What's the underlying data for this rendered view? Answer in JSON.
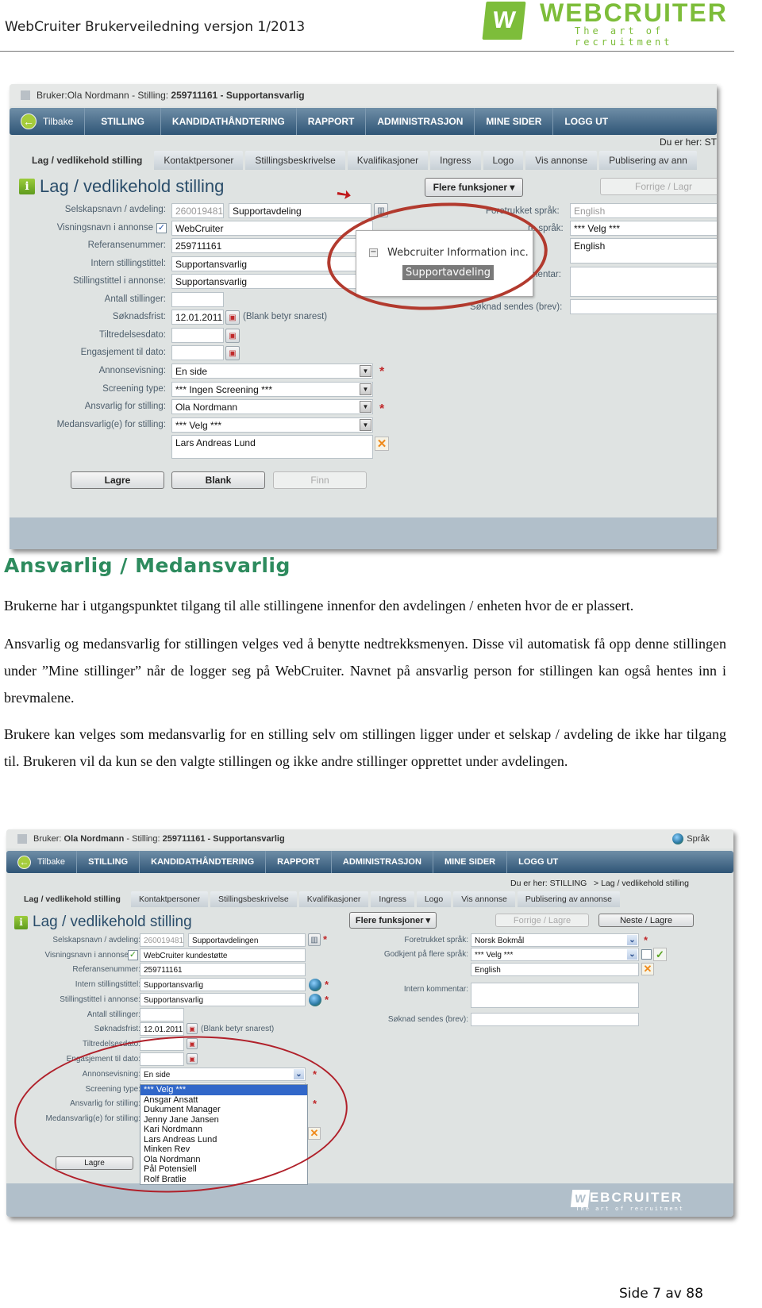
{
  "page_header": {
    "doc_title": "WebCruiter Brukerveiledning versjon 1/2013",
    "logo_text": "WEBCRUITER",
    "logo_tagline": "The art of recruitment",
    "logo_mark": "W"
  },
  "screenshot1": {
    "titlebar": {
      "user_label": "Bruker:",
      "user_name": "Ola Nordmann",
      "sep1": " - Stilling: ",
      "position_id": "259711161",
      "sep2": " - ",
      "position_title": "Supportansvarlig"
    },
    "nav": {
      "back": "Tilbake",
      "items": [
        "STILLING",
        "KANDIDATHÅNDTERING",
        "RAPPORT",
        "ADMINISTRASJON",
        "MINE SIDER",
        "LOGG UT"
      ]
    },
    "breadcrumb": "Du er her: ST",
    "tabs": [
      "Lag / vedlikehold stilling",
      "Kontaktpersoner",
      "Stillingsbeskrivelse",
      "Kvalifikasjoner",
      "Ingress",
      "Logo",
      "Vis annonse",
      "Publisering av ann"
    ],
    "panel_title": "Lag / vedlikehold stilling",
    "more_functions": "Flere funksjoner ▾",
    "prev_save": "Forrige / Lagr",
    "fields": {
      "company_label": "Selskapsnavn / avdeling:",
      "company_id": "260019481",
      "company_name": "Supportavdeling",
      "display_name_label": "Visningsnavn i annonse",
      "display_name": "WebCruiter",
      "reference_label": "Referansenummer:",
      "reference": "259711161",
      "internal_title_label": "Intern stillingstittel:",
      "internal_title": "Supportansvarlig",
      "ad_title_label": "Stillingstittel i annonse:",
      "ad_title": "Supportansvarlig",
      "count_label": "Antall stillinger:",
      "count": "",
      "deadline_label": "Søknadsfrist:",
      "deadline": "12.01.2011",
      "deadline_hint": "(Blank betyr snarest)",
      "start_label": "Tiltredelsesdato:",
      "start": "",
      "engagement_label": "Engasjement til dato:",
      "engagement": "",
      "ad_display_label": "Annonsevisning:",
      "ad_display": "En side",
      "screening_label": "Screening type:",
      "screening": "*** Ingen Screening ***",
      "responsible_label": "Ansvarlig for stilling:",
      "responsible": "Ola Nordmann",
      "coresponsible_label": "Medansvarlig(e) for stilling:",
      "coresponsible": "*** Velg ***",
      "coresponsible_list": "Lars Andreas Lund",
      "pref_lang_label": "Foretrukket språk:",
      "pref_lang": "English",
      "multi_lang_label": "Godkjent på flere språk:",
      "multi_lang_visible_label": "re språk:",
      "multi_lang": "*** Velg ***",
      "multi_lang_list": "English",
      "comment_label": "Intern kommentar:",
      "comment_visible_label": "ommentar:",
      "send_label": "Søknad sendes (brev):"
    },
    "popup": {
      "root": "Webcruiter Information inc.",
      "child": "Supportavdeling"
    },
    "buttons": {
      "save": "Lagre",
      "blank": "Blank",
      "find": "Finn"
    }
  },
  "section": {
    "heading": "Ansvarlig / Medansvarlig",
    "paragraphs": [
      "Brukerne har i utgangspunktet tilgang til alle stillingene innenfor den avdelingen / enheten hvor de er plassert.",
      "Ansvarlig og medansvarlig for stillingen velges ved å benytte nedtrekksmenyen. Disse vil automatisk få opp denne stillingen under ”Mine stillinger” når de logger seg på WebCruiter. Navnet på ansvarlig person for stillingen kan også hentes inn i brevmalene.",
      "Brukere kan velges som medansvarlig for en stilling selv om stillingen ligger under et selskap / avdeling de ikke har tilgang til. Brukeren vil da kun se den valgte stillingen og ikke andre stillinger opprettet under avdelingen."
    ]
  },
  "screenshot2": {
    "titlebar": {
      "user_label": "Bruker: ",
      "user_name": "Ola Nordmann",
      "sep1": " - Stilling: ",
      "position_id": "259711161",
      "sep2": " - ",
      "position_title": "Supportansvarlig",
      "language": "Språk"
    },
    "nav": {
      "back": "Tilbake",
      "items": [
        "STILLING",
        "KANDIDATHÅNDTERING",
        "RAPPORT",
        "ADMINISTRASJON",
        "MINE SIDER",
        "LOGG UT"
      ]
    },
    "breadcrumb": "Du er her: STILLING   > Lag / vedlikehold stilling",
    "tabs": [
      "Lag / vedlikehold stilling",
      "Kontaktpersoner",
      "Stillingsbeskrivelse",
      "Kvalifikasjoner",
      "Ingress",
      "Logo",
      "Vis annonse",
      "Publisering av annonse"
    ],
    "panel_title": "Lag / vedlikehold stilling",
    "more_functions": "Flere funksjoner ▾",
    "prev_save": "Forrige / Lagre",
    "next_save": "Neste / Lagre",
    "fields": {
      "company_label": "Selskapsnavn / avdeling:",
      "company_id": "260019481",
      "company_name": "Supportavdelingen",
      "display_name_label": "Visningsnavn i annonse",
      "display_name": "WebCruiter kundestøtte",
      "reference_label": "Referansenummer:",
      "reference": "259711161",
      "internal_title_label": "Intern stillingstittel:",
      "internal_title": "Supportansvarlig",
      "ad_title_label": "Stillingstittel i annonse:",
      "ad_title": "Supportansvarlig",
      "count_label": "Antall stillinger:",
      "deadline_label": "Søknadsfrist:",
      "deadline": "12.01.2011",
      "deadline_hint": "(Blank betyr snarest)",
      "start_label": "Tiltredelsesdato:",
      "engagement_label": "Engasjement til dato:",
      "ad_display_label": "Annonsevisning:",
      "ad_display": "En side",
      "screening_label": "Screening type:",
      "screening": "*** Ingen Screening ***",
      "responsible_label": "Ansvarlig for stilling:",
      "responsible": "Ola Nordmann",
      "coresponsible_label": "Medansvarlig(e) for stilling:",
      "coresponsible": "*** Velg ***",
      "pref_lang_label": "Foretrukket språk:",
      "pref_lang": "Norsk Bokmål",
      "multi_lang_label": "Godkjent på flere språk:",
      "multi_lang": "*** Velg ***",
      "multi_lang_list": "English",
      "comment_label": "Intern kommentar:",
      "send_label": "Søknad sendes (brev):"
    },
    "dropdown_options": [
      "*** Velg ***",
      "Ansgar Ansatt",
      "Dukument Manager",
      "Jenny Jane Jansen",
      "Kari Nordmann",
      "Lars Andreas Lund",
      "Minken Rev",
      "Ola Nordmann",
      "Pål Potensiell",
      "Rolf Bratlie"
    ],
    "dropdown_selected": "*** Velg ***",
    "buttons": {
      "save": "Lagre"
    },
    "footer_logo": "WEBCRUITER",
    "footer_tagline": "The art of recruitment"
  },
  "page_footer": {
    "page_number": "Side 7 av 88"
  },
  "colors": {
    "heading_green": "#2e8b5e",
    "nav_blue": "#2f5576",
    "brand_green": "#7dbd3a",
    "annotation_red": "#b23a2e"
  }
}
